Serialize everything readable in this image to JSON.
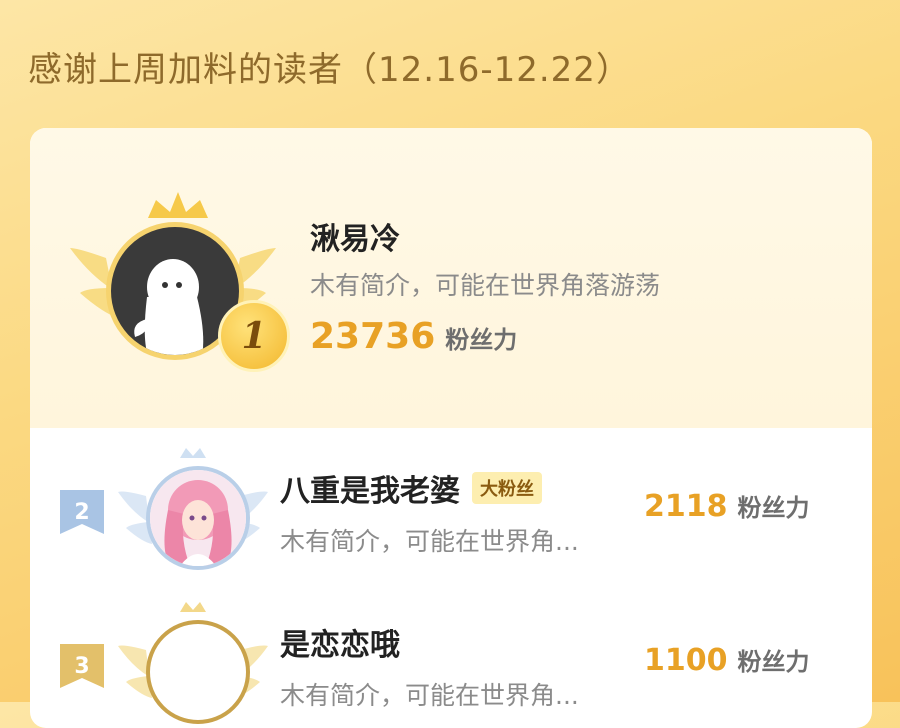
{
  "header": {
    "title": "感谢上周加料的读者（12.16-12.22）"
  },
  "top_reader": {
    "rank": "1",
    "name": "湫易冷",
    "bio": "木有简介，可能在世界角落游荡",
    "fans_value": "23736",
    "fans_label": "粉丝力"
  },
  "readers": [
    {
      "rank": "2",
      "name": "八重是我老婆",
      "tag": "大粉丝",
      "bio": "木有简介，可能在世界角...",
      "fans_value": "2118",
      "fans_label": "粉丝力"
    },
    {
      "rank": "3",
      "name": "是恋恋哦",
      "bio": "木有简介，可能在世界角...",
      "fans_value": "1100",
      "fans_label": "粉丝力"
    }
  ],
  "colors": {
    "accent": "#e8a125",
    "gold": "#f6d36e",
    "silver": "#9bb8d8",
    "bronze": "#e7c46e"
  }
}
